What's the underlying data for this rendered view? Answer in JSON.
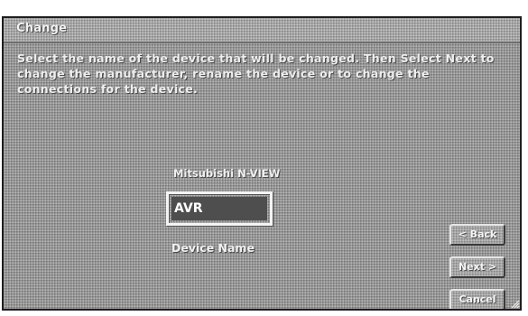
{
  "window": {
    "title": "Change"
  },
  "instructions": "Select the name of the device that will be changed. Then Select Next to change the manufacturer, rename the device or to change the connections for the device.",
  "device": {
    "type_label": "Mitsubishi N-VIEW",
    "name_value": "AVR",
    "name_label": "Device Name"
  },
  "buttons": {
    "back": "< Back",
    "next": "Next >",
    "cancel": "Cancel"
  },
  "icons": {
    "resize_grip": "resize-grip-icon"
  },
  "colors": {
    "panel": "#9a9a9a",
    "field": "#4e4e4e",
    "text": "#eeeeee"
  }
}
